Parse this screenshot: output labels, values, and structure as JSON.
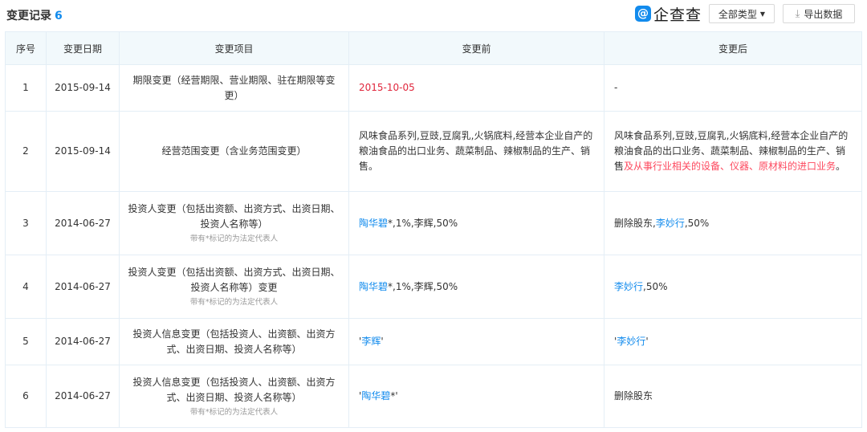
{
  "header": {
    "title": "变更记录",
    "count": "6",
    "logo_mark": "@",
    "logo_text": "企查查",
    "type_button": "全部类型",
    "export_button": "导出数据"
  },
  "columns": [
    "序号",
    "变更日期",
    "变更项目",
    "变更前",
    "变更后"
  ],
  "rows": [
    {
      "no": "1",
      "date": "2015-09-14",
      "item": "期限变更（经营期限、营业期限、驻在期限等变更）",
      "before": "2015-10-05",
      "after": "-"
    },
    {
      "no": "2",
      "date": "2015-09-14",
      "item": "经营范围变更（含业务范围变更）",
      "before": "风味食品系列,豆豉,豆腐乳,火锅底料,经营本企业自产的粮油食品的出口业务、蔬菜制品、辣椒制品的生产、销售。",
      "after_plain": "风味食品系列,豆豉,豆腐乳,火锅底料,经营本企业自产的粮油食品的出口业务、蔬菜制品、辣椒制品的生产、销售",
      "after_red": "及从事行业相关的设备、仪器、原材料的进口业务",
      "after_end": "。"
    },
    {
      "no": "3",
      "date": "2014-06-27",
      "item": "投资人变更（包括出资额、出资方式、出资日期、投资人名称等）",
      "note": "带有*标记的为法定代表人",
      "before_link": "陶华碧",
      "before_rest": "*,1%,李辉,50%",
      "after_prefix": "删除股东,",
      "after_link": "李妙行",
      "after_rest": ",50%"
    },
    {
      "no": "4",
      "date": "2014-06-27",
      "item": "投资人变更（包括出资额、出资方式、出资日期、投资人名称等）变更",
      "note": "带有*标记的为法定代表人",
      "before_link": "陶华碧",
      "before_rest": "*,1%,李辉,50%",
      "after_link": "李妙行",
      "after_rest": ",50%"
    },
    {
      "no": "5",
      "date": "2014-06-27",
      "item": "投资人信息变更（包括投资人、出资额、出资方式、出资日期、投资人名称等）",
      "before_q1": "'",
      "before_link": "李辉",
      "before_q2": "'",
      "after_q1": "'",
      "after_link": "李妙行",
      "after_q2": "'"
    },
    {
      "no": "6",
      "date": "2014-06-27",
      "item": "投资人信息变更（包括投资人、出资额、出资方式、出资日期、投资人名称等）",
      "note": "带有*标记的为法定代表人",
      "before_q1": "'",
      "before_link": "陶华碧",
      "before_q2": "*'",
      "after": "删除股东"
    }
  ]
}
